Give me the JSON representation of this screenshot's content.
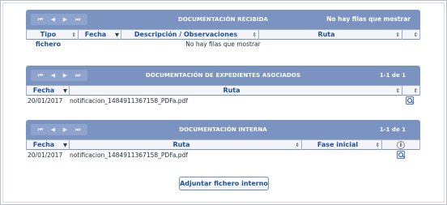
{
  "pager_icons": [
    "first-page-icon",
    "prev-page-icon",
    "next-page-icon",
    "last-page-icon"
  ],
  "pager_glyphs": {
    "first": "⏮",
    "prev": "◀",
    "next": "▶",
    "last": "⏭"
  },
  "colors": {
    "bar": "#7a93c0",
    "header_text": "#1c4f9c",
    "border": "#9fb0cf"
  },
  "recibida": {
    "title": "DOCUMENTACIÓN RECIBIDA",
    "count": "No hay filas que mostrar",
    "columns": [
      "Tipo fichero",
      "Fecha",
      "Descripción / Observaciones",
      "Ruta",
      ""
    ],
    "empty": "No hay filas que mostrar"
  },
  "expedientes": {
    "title": "DOCUMENTACIÓN DE EXPEDIENTES ASOCIADOS",
    "count": "1-1 de 1",
    "columns": [
      "Fecha",
      "Ruta",
      ""
    ],
    "rows": [
      {
        "fecha": "20/01/2017",
        "ruta": "notificacion_1484911367158_PDFa.pdf"
      }
    ]
  },
  "interna": {
    "title": "DOCUMENTACIÓN INTERNA",
    "count": "1-1 de 1",
    "columns": [
      "Fecha",
      "Ruta",
      "Fase inicial",
      ""
    ],
    "rows": [
      {
        "fecha": "20/01/2017",
        "ruta": "notificacion_1484911367158_PDFa.pdf",
        "fase": ""
      }
    ]
  },
  "sort_glyphs": {
    "both": "⇕",
    "down": "▼"
  },
  "adjuntar_label": "Adjuntar fichero interno"
}
